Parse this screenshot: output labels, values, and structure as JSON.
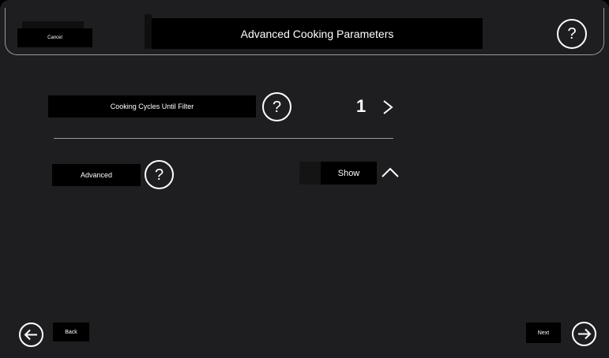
{
  "header": {
    "cancel_label": "Cancel",
    "title": "Advanced Cooking Parameters",
    "help_glyph": "?"
  },
  "settings": {
    "cooking_cycles": {
      "label": "Cooking Cycles Until Filter",
      "value": "1",
      "help_glyph": "?"
    },
    "advanced": {
      "label": "Advanced",
      "help_glyph": "?",
      "toggle_label": "Show"
    }
  },
  "footer": {
    "back_label": "Back",
    "next_label": "Next"
  },
  "icons": {
    "help": "question-circle-icon",
    "chevron_right": "chevron-right-icon",
    "chevron_up": "chevron-up-icon",
    "arrow_left": "arrow-left-icon",
    "arrow_right": "arrow-right-icon"
  },
  "colors": {
    "background": "#1e1e21",
    "button": "#000000",
    "text": "#ffffff",
    "divider": "#9a9a9a"
  }
}
